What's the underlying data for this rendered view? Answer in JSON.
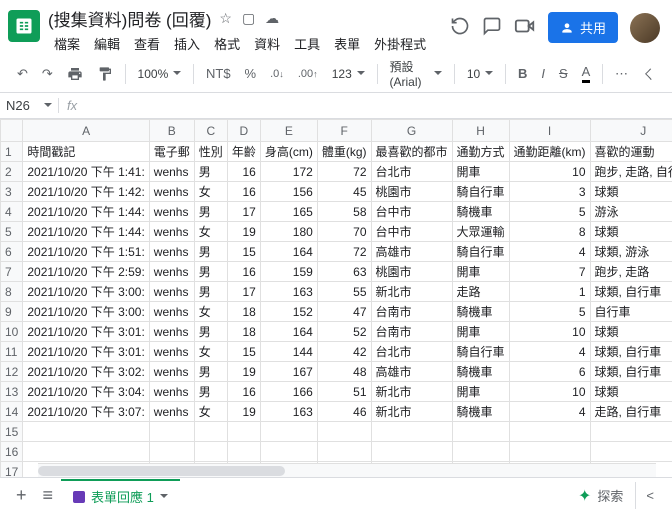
{
  "doc": {
    "title": "(搜集資料)問卷 (回覆)"
  },
  "menus": [
    "檔案",
    "編輯",
    "查看",
    "插入",
    "格式",
    "資料",
    "工具",
    "表單",
    "外掛程式"
  ],
  "share_label": "共用",
  "toolbar": {
    "zoom": "100%",
    "currency": "NT$",
    "percent": "%",
    "dec_dec": ".0",
    "dec_inc": ".00",
    "numfmt": "123",
    "font": "預設 (Arial)",
    "fontsize": "10"
  },
  "namebox": "N26",
  "sheet_tab": "表單回應 1",
  "explore_label": "探索",
  "chart_data": {
    "type": "table",
    "columns": [
      "時間戳記",
      "電子郵",
      "性別",
      "年齡",
      "身高(cm)",
      "體重(kg)",
      "最喜歡的都市",
      "通勤方式",
      "通勤距離(km)",
      "喜歡的運動"
    ],
    "col_letters": [
      "A",
      "B",
      "C",
      "D",
      "E",
      "F",
      "G",
      "H",
      "I",
      "J"
    ],
    "rows": [
      [
        "2021/10/20 下午 1:41:",
        "wenhs",
        "男",
        16,
        172,
        72,
        "台北市",
        "開車",
        10,
        "跑步, 走路, 自行車"
      ],
      [
        "2021/10/20 下午 1:42:",
        "wenhs",
        "女",
        16,
        156,
        45,
        "桃園市",
        "騎自行車",
        3,
        "球類"
      ],
      [
        "2021/10/20 下午 1:44:",
        "wenhs",
        "男",
        17,
        165,
        58,
        "台中市",
        "騎機車",
        5,
        "游泳"
      ],
      [
        "2021/10/20 下午 1:44:",
        "wenhs",
        "女",
        19,
        180,
        70,
        "台中市",
        "大眾運輸",
        8,
        "球類"
      ],
      [
        "2021/10/20 下午 1:51:",
        "wenhs",
        "男",
        15,
        164,
        72,
        "高雄市",
        "騎自行車",
        4,
        "球類, 游泳"
      ],
      [
        "2021/10/20 下午 2:59:",
        "wenhs",
        "男",
        16,
        159,
        63,
        "桃園市",
        "開車",
        7,
        "跑步, 走路"
      ],
      [
        "2021/10/20 下午 3:00:",
        "wenhs",
        "男",
        17,
        163,
        55,
        "新北市",
        "走路",
        1,
        "球類, 自行車"
      ],
      [
        "2021/10/20 下午 3:00:",
        "wenhs",
        "女",
        18,
        152,
        47,
        "台南市",
        "騎機車",
        5,
        "自行車"
      ],
      [
        "2021/10/20 下午 3:01:",
        "wenhs",
        "男",
        18,
        164,
        52,
        "台南市",
        "開車",
        10,
        "球類"
      ],
      [
        "2021/10/20 下午 3:01:",
        "wenhs",
        "女",
        15,
        144,
        42,
        "台北市",
        "騎自行車",
        4,
        "球類, 自行車"
      ],
      [
        "2021/10/20 下午 3:02:",
        "wenhs",
        "男",
        19,
        167,
        48,
        "高雄市",
        "騎機車",
        6,
        "球類, 自行車"
      ],
      [
        "2021/10/20 下午 3:04:",
        "wenhs",
        "男",
        16,
        166,
        51,
        "新北市",
        "開車",
        10,
        "球類"
      ],
      [
        "2021/10/20 下午 3:07:",
        "wenhs",
        "女",
        19,
        163,
        46,
        "新北市",
        "騎機車",
        4,
        "走路, 自行車"
      ]
    ]
  }
}
